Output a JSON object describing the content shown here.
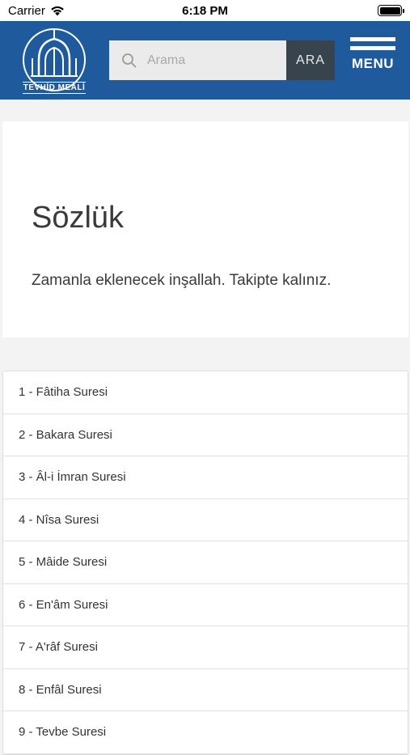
{
  "status_bar": {
    "carrier": "Carrier",
    "time": "6:18 PM"
  },
  "header": {
    "logo_text": "TEVHİD MEALİ",
    "search_placeholder": "Arama",
    "search_button": "ARA",
    "menu_label": "MENU",
    "colors": {
      "header_bg": "#1f5b9c",
      "button_bg": "#37444d"
    }
  },
  "card": {
    "title": "Sözlük",
    "text": "Zamanla eklenecek inşallah. Takipte kalınız."
  },
  "suras": [
    "1 - Fâtiha Suresi",
    "2 - Bakara Suresi",
    "3 - Âl-i İmran Suresi",
    "4 - Nîsa Suresi",
    "5 - Mâide Suresi",
    "6 - En'âm Suresi",
    "7 - A'râf Suresi",
    "8 - Enfâl Suresi",
    "9 - Tevbe Suresi"
  ]
}
